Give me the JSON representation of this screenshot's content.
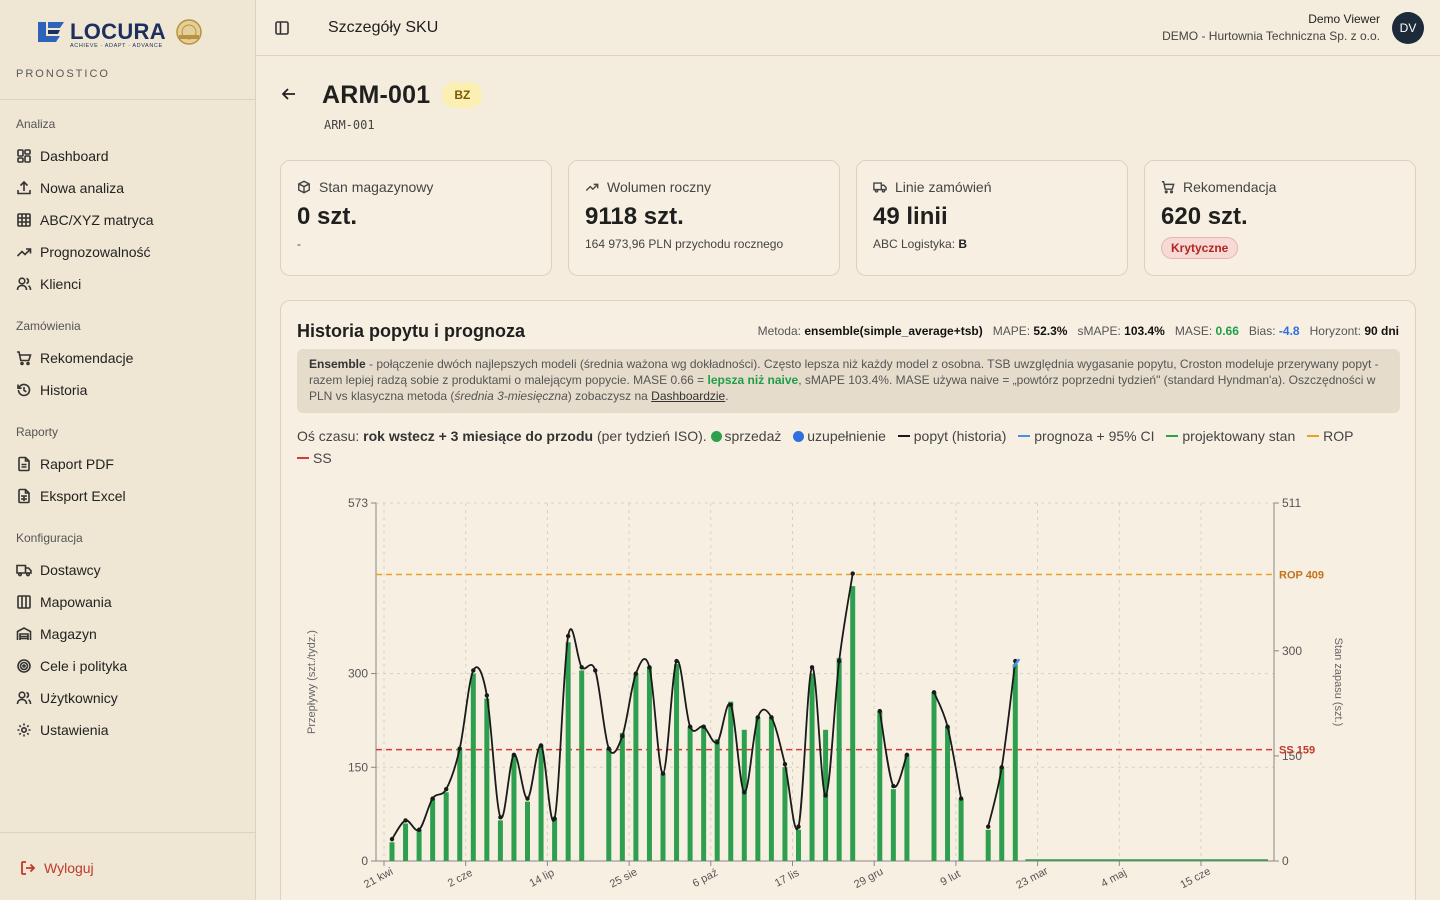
{
  "brand": {
    "name": "LOCURA",
    "tagline": "ACHIEVE · ADAPT · ADVANCE",
    "product": "PRONOSTICO"
  },
  "nav": {
    "sections": [
      {
        "heading": "Analiza",
        "items": [
          {
            "label": "Dashboard",
            "icon": "layout-grid-icon"
          },
          {
            "label": "Nowa analiza",
            "icon": "upload-icon"
          },
          {
            "label": "ABC/XYZ matryca",
            "icon": "table-grid-icon"
          },
          {
            "label": "Prognozowalność",
            "icon": "trend-up-icon"
          },
          {
            "label": "Klienci",
            "icon": "users-icon"
          }
        ]
      },
      {
        "heading": "Zamówienia",
        "items": [
          {
            "label": "Rekomendacje",
            "icon": "cart-icon"
          },
          {
            "label": "Historia",
            "icon": "history-icon"
          }
        ]
      },
      {
        "heading": "Raporty",
        "items": [
          {
            "label": "Raport PDF",
            "icon": "file-icon"
          },
          {
            "label": "Eksport Excel",
            "icon": "spreadsheet-icon"
          }
        ]
      },
      {
        "heading": "Konfiguracja",
        "items": [
          {
            "label": "Dostawcy",
            "icon": "truck-icon"
          },
          {
            "label": "Mapowania",
            "icon": "columns-icon"
          },
          {
            "label": "Magazyn",
            "icon": "warehouse-icon"
          },
          {
            "label": "Cele i polityka",
            "icon": "target-icon"
          },
          {
            "label": "Użytkownicy",
            "icon": "user-group-icon"
          },
          {
            "label": "Ustawienia",
            "icon": "gear-icon"
          }
        ]
      }
    ],
    "logout": "Wyloguj"
  },
  "topbar": {
    "title": "Szczegóły SKU",
    "user_name": "Demo Viewer",
    "user_org": "DEMO - Hurtownia Techniczna Sp. z o.o.",
    "avatar": "DV"
  },
  "sku": {
    "title": "ARM-001",
    "badge": "BZ",
    "code": "ARM-001"
  },
  "cards": [
    {
      "label": "Stan magazynowy",
      "value": "0 szt.",
      "sub": "-"
    },
    {
      "label": "Wolumen roczny",
      "value": "9118 szt.",
      "sub": "164 973,96 PLN przychodu rocznego"
    },
    {
      "label": "Linie zamówień",
      "value": "49 linii",
      "sub_prefix": "ABC Logistyka:",
      "sub_value": "B"
    },
    {
      "label": "Rekomendacja",
      "value": "620 szt.",
      "badge": "Krytyczne"
    }
  ],
  "panel": {
    "title": "Historia popytu i prognoza",
    "metrics": {
      "method_label": "Metoda:",
      "method": "ensemble(simple_average+tsb)",
      "mape_label": "MAPE:",
      "mape": "52.3%",
      "smape_label": "sMAPE:",
      "smape": "103.4%",
      "mase_label": "MASE:",
      "mase": "0.66",
      "bias_label": "Bias:",
      "bias": "-4.8",
      "horizon_label": "Horyzont:",
      "horizon": "90 dni"
    },
    "note": {
      "lead": "Ensemble",
      "text1": " - połączenie dwóch najlepszych modeli (średnia ważona wg dokładności). Często lepsza niż każdy model z osobna. TSB uwzględnia wygasanie popytu, Croston modeluje przerywany popyt - razem lepiej radzą sobie z produktami o malejącym popycie.  MASE 0.66 = ",
      "highlight": "lepsza niż naive",
      "text2": ", sMAPE 103.4%. MASE używa naive = „powtórz poprzedni tydzień\" (standard Hyndman'a). Oszczędności w PLN vs klasyczna metoda (",
      "italic": "średnia 3-miesięczna",
      "text3": ") zobaczysz na ",
      "link": "Dashboardzie",
      "text4": "."
    },
    "legend": {
      "axis_prefix": "Oś czasu:",
      "axis_bold": "rok wstecz + 3 miesiące do przodu",
      "axis_suffix": "(per tydzień ISO).",
      "items": [
        {
          "label": "sprzedaż",
          "color": "#2e9e4f",
          "kind": "dot"
        },
        {
          "label": "uzupełnienie",
          "color": "#2f6fde",
          "kind": "dot"
        },
        {
          "label": "popyt (historia)",
          "color": "#1a1a1a",
          "kind": "line"
        },
        {
          "label": "prognoza + 95% CI",
          "color": "#4a8fe6",
          "kind": "line"
        },
        {
          "label": "projektowany stan",
          "color": "#2e9e4f",
          "kind": "line"
        },
        {
          "label": "ROP",
          "color": "#e8a22a",
          "kind": "line"
        },
        {
          "label": "SS",
          "color": "#d63b3b",
          "kind": "line"
        }
      ]
    }
  },
  "chart_data": {
    "type": "bar",
    "ylabel_left": "Przepływy (szt./tydz.)",
    "ylabel_right": "Stan zapasu (szt.)",
    "left_ticks": [
      "573",
      "300",
      "150",
      "0"
    ],
    "right_ticks": [
      "511",
      "300",
      "150",
      "0"
    ],
    "ylim_left": [
      0,
      573
    ],
    "ylim_right": [
      0,
      511
    ],
    "x_tick_labels": [
      "21 kwi",
      "2 cze",
      "14 lip",
      "25 sie",
      "6 paź",
      "17 lis",
      "29 gru",
      "9 lut",
      "23 mar",
      "4 maj",
      "15 cze"
    ],
    "sales": [
      30,
      60,
      50,
      100,
      110,
      180,
      300,
      260,
      65,
      170,
      95,
      185,
      68,
      350,
      305,
      0,
      180,
      205,
      300,
      310,
      140,
      315,
      215,
      215,
      195,
      255,
      210,
      230,
      230,
      150,
      50,
      300,
      210,
      325,
      440,
      0,
      240,
      115,
      170,
      0,
      270,
      215,
      100,
      0,
      50,
      150,
      315
    ],
    "demand": [
      35,
      65,
      50,
      100,
      115,
      180,
      305,
      265,
      70,
      170,
      100,
      185,
      68,
      360,
      310,
      305,
      180,
      200,
      300,
      310,
      140,
      320,
      215,
      215,
      190,
      250,
      110,
      230,
      230,
      155,
      55,
      310,
      105,
      320,
      460,
      null,
      240,
      120,
      170,
      null,
      270,
      215,
      100,
      null,
      55,
      150,
      320
    ],
    "rop": 409,
    "ss": 159,
    "rop_label": "ROP 409",
    "ss_label": "SS 159",
    "projected_stock": 0
  }
}
